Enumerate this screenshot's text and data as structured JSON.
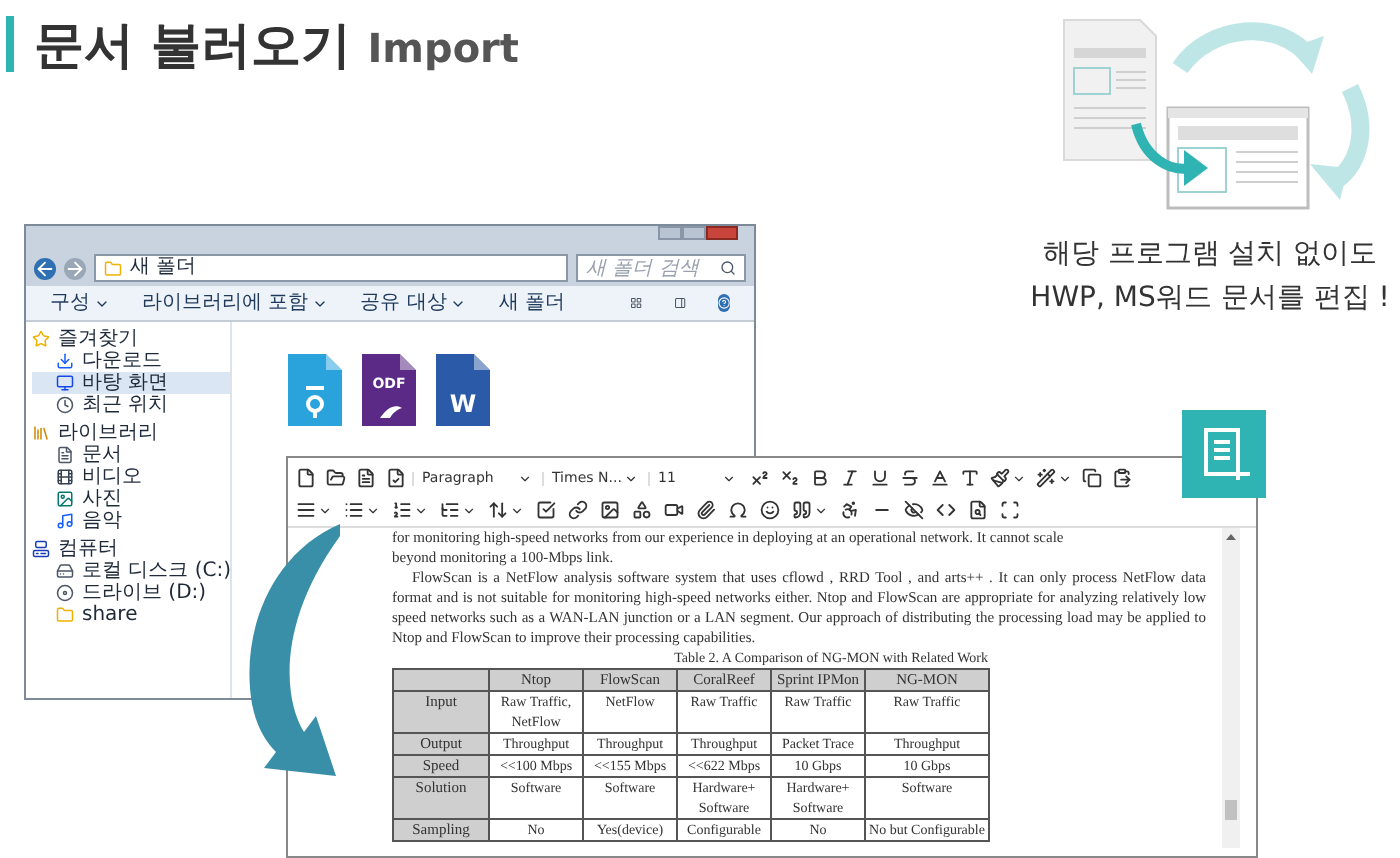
{
  "title": {
    "main": "문서 불러오기",
    "sub": "Import"
  },
  "explorer": {
    "address": "새 폴더",
    "search_placeholder": "새 폴더 검색",
    "toolbar": [
      {
        "label": "구성",
        "dropdown": true
      },
      {
        "label": "라이브러리에 포함",
        "dropdown": true
      },
      {
        "label": "공유 대상",
        "dropdown": true
      },
      {
        "label": "새 폴더",
        "dropdown": false
      }
    ],
    "sidebar": [
      {
        "label": "즐겨찾기",
        "kind": "star",
        "selected": false,
        "children": [
          {
            "label": "다운로드",
            "kind": "download",
            "selected": false
          },
          {
            "label": "바탕 화면",
            "kind": "desktop",
            "selected": true
          },
          {
            "label": "최근 위치",
            "kind": "recent",
            "selected": false
          }
        ]
      },
      {
        "label": "라이브러리",
        "kind": "library",
        "selected": false,
        "children": [
          {
            "label": "문서",
            "kind": "document",
            "selected": false
          },
          {
            "label": "비디오",
            "kind": "video",
            "selected": false
          },
          {
            "label": "사진",
            "kind": "picture",
            "selected": false
          },
          {
            "label": "음악",
            "kind": "music",
            "selected": false
          }
        ]
      },
      {
        "label": "컴퓨터",
        "kind": "computer",
        "selected": false,
        "children": [
          {
            "label": "로컬 디스크 (C:)",
            "kind": "disk",
            "selected": false
          },
          {
            "label": "드라이브 (D:)",
            "kind": "drive",
            "selected": false
          },
          {
            "label": "share",
            "kind": "folder",
            "selected": false
          }
        ]
      }
    ],
    "files": [
      {
        "kind": "hwp"
      },
      {
        "kind": "odf",
        "label": "ODF"
      },
      {
        "kind": "word",
        "label": "W"
      }
    ]
  },
  "editor": {
    "selects": [
      {
        "value": "Paragraph"
      },
      {
        "value": "Times N..."
      },
      {
        "value": "11"
      }
    ],
    "top_line": "for monitoring high-speed networks from our experience in deploying at an operational network. It cannot scale",
    "lines": [
      "beyond monitoring a 100-Mbps link."
    ],
    "paragraph": "FlowScan  is a NetFlow analysis software system that uses cflowd , RRD Tool , and arts++ . It can only process NetFlow  data format and is not suitable for monitoring high-speed networks either. Ntop and FlowScan are appropriate for analyzing relatively low speed networks such as a WAN-LAN junction or a LAN segment. Our approach of distributing the processing load may be applied to Ntop and FlowScan to improve their processing capabilities.",
    "table": {
      "caption": "Table 2. A Comparison of NG-MON with Related Work",
      "columns": [
        "Ntop",
        "FlowScan",
        "CoralReef",
        "Sprint IPMon",
        "NG-MON"
      ],
      "rows": [
        {
          "label": "Input",
          "cells": [
            "Raw Traffic, NetFlow",
            "NetFlow",
            "Raw Traffic",
            "Raw Traffic",
            "Raw Traffic"
          ]
        },
        {
          "label": "Output",
          "cells": [
            "Throughput",
            "Throughput",
            "Throughput",
            "Packet Trace",
            "Throughput"
          ]
        },
        {
          "label": "Speed",
          "cells": [
            "<<100 Mbps",
            "<<155 Mbps",
            "<<622 Mbps",
            "10 Gbps",
            "10 Gbps"
          ]
        },
        {
          "label": "Solution",
          "cells": [
            "Software",
            "Software",
            "Hardware+ Software",
            "Hardware+ Software",
            "Software"
          ]
        },
        {
          "label": "Sampling",
          "cells": [
            "No",
            "Yes(device)",
            "Configurable",
            "No",
            "No but Configurable"
          ]
        }
      ]
    }
  },
  "caption": [
    "해당 프로그램 설치 없이도",
    "HWP, MS워드 문서를 편집 !"
  ]
}
